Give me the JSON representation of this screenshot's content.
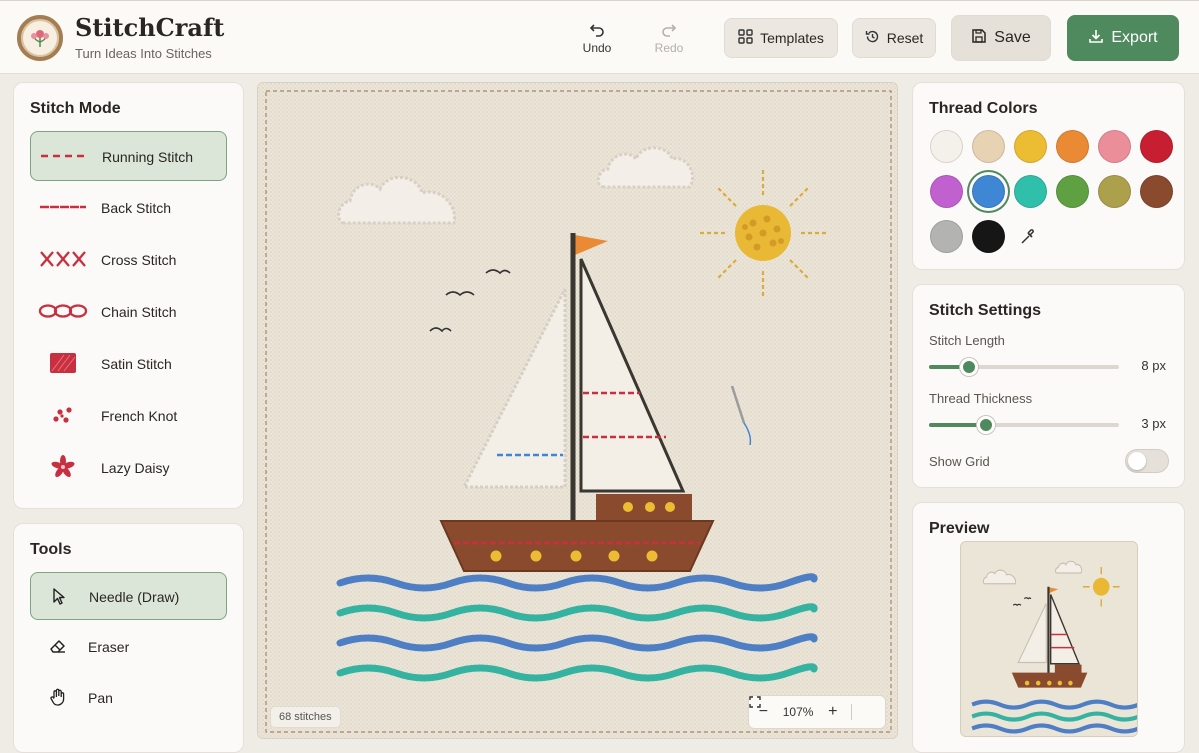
{
  "app": {
    "title": "StitchCraft",
    "subtitle": "Turn Ideas Into Stitches"
  },
  "toolbar": {
    "undo_label": "Undo",
    "redo_label": "Redo",
    "templates_label": "Templates",
    "reset_label": "Reset",
    "save_label": "Save",
    "export_label": "Export",
    "accent": "#4f8a5e"
  },
  "stitch_mode": {
    "title": "Stitch Mode",
    "items": [
      {
        "label": "Running Stitch",
        "icon": "running-stitch-icon",
        "active": true
      },
      {
        "label": "Back Stitch",
        "icon": "back-stitch-icon",
        "active": false
      },
      {
        "label": "Cross Stitch",
        "icon": "cross-stitch-icon",
        "active": false
      },
      {
        "label": "Chain Stitch",
        "icon": "chain-stitch-icon",
        "active": false
      },
      {
        "label": "Satin Stitch",
        "icon": "satin-stitch-icon",
        "active": false
      },
      {
        "label": "French Knot",
        "icon": "french-knot-icon",
        "active": false
      },
      {
        "label": "Lazy Daisy",
        "icon": "lazy-daisy-icon",
        "active": false
      }
    ]
  },
  "tools": {
    "title": "Tools",
    "items": [
      {
        "label": "Needle (Draw)",
        "icon": "cursor-icon",
        "active": true
      },
      {
        "label": "Eraser",
        "icon": "eraser-icon",
        "active": false
      },
      {
        "label": "Pan",
        "icon": "hand-icon",
        "active": false
      }
    ]
  },
  "canvas": {
    "stitch_count": "68 stitches",
    "zoom": "107%"
  },
  "thread_colors": {
    "title": "Thread Colors",
    "colors": [
      "#f4f1ea",
      "#e8d2b4",
      "#ecbd33",
      "#ea8a35",
      "#ec8e99",
      "#c81e32",
      "#c061cf",
      "#3f86d4",
      "#2fbfab",
      "#5fa142",
      "#aca04d",
      "#8a4a2e",
      "#b3b3b1",
      "#161616"
    ],
    "selected": "#3f86d4"
  },
  "stitch_settings": {
    "title": "Stitch Settings",
    "length_label": "Stitch Length",
    "length_value": "8 px",
    "length_fraction": 0.21,
    "thickness_label": "Thread Thickness",
    "thickness_value": "3 px",
    "thickness_fraction": 0.3,
    "grid_label": "Show Grid",
    "grid_on": false
  },
  "preview": {
    "title": "Preview"
  }
}
